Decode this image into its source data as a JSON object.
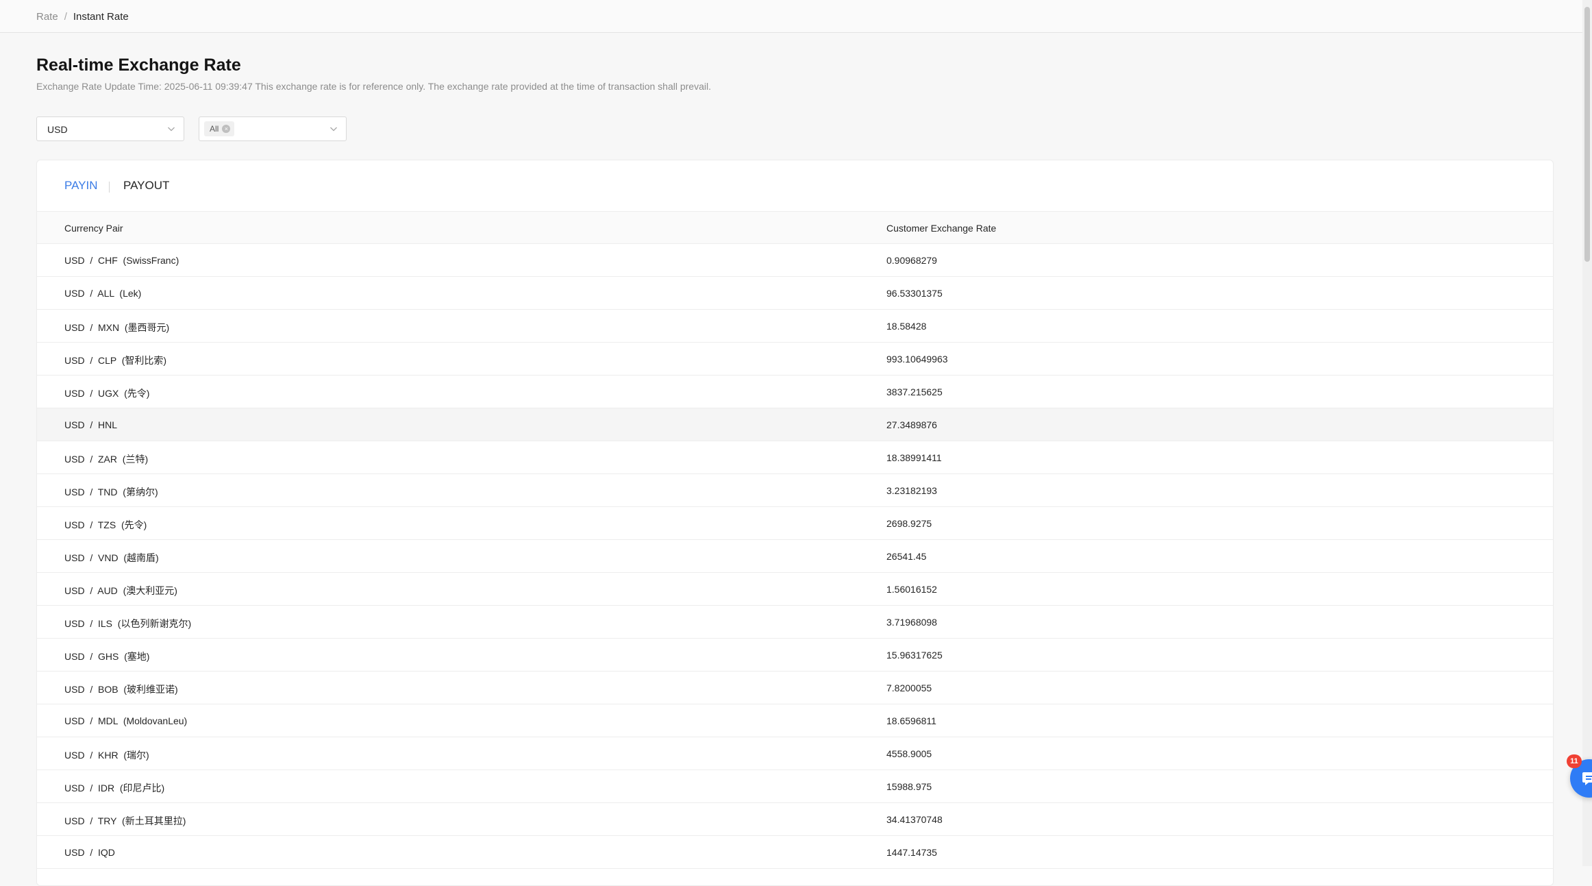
{
  "breadcrumb": {
    "parent": "Rate",
    "separator": "/",
    "current": "Instant Rate"
  },
  "page": {
    "title": "Real-time Exchange Rate",
    "update_text": "Exchange Rate Update Time: 2025-06-11 09:39:47 This exchange rate is for reference only. The exchange rate provided at the time of transaction shall prevail."
  },
  "filters": {
    "currency_value": "USD",
    "region_tag": "All",
    "region_tag_clear": "×"
  },
  "tabs": {
    "payin": "PAYIN",
    "payout": "PAYOUT",
    "active": "PAYIN"
  },
  "table": {
    "headers": [
      "Currency Pair",
      "Customer Exchange Rate"
    ],
    "rows": [
      {
        "pair": "USD  /  CHF  (SwissFranc)",
        "rate": "0.90968279"
      },
      {
        "pair": "USD  /  ALL  (Lek)",
        "rate": "96.53301375"
      },
      {
        "pair": "USD  /  MXN  (墨西哥元)",
        "rate": "18.58428"
      },
      {
        "pair": "USD  /  CLP  (智利比索)",
        "rate": "993.10649963"
      },
      {
        "pair": "USD  /  UGX  (先令)",
        "rate": "3837.215625"
      },
      {
        "pair": "USD  /  HNL",
        "rate": "27.3489876"
      },
      {
        "pair": "USD  /  ZAR  (兰特)",
        "rate": "18.38991411"
      },
      {
        "pair": "USD  /  TND  (第纳尔)",
        "rate": "3.23182193"
      },
      {
        "pair": "USD  /  TZS  (先令)",
        "rate": "2698.9275"
      },
      {
        "pair": "USD  /  VND  (越南盾)",
        "rate": "26541.45"
      },
      {
        "pair": "USD  /  AUD  (澳大利亚元)",
        "rate": "1.56016152"
      },
      {
        "pair": "USD  /  ILS  (以色列新谢克尔)",
        "rate": "3.71968098"
      },
      {
        "pair": "USD  /  GHS  (塞地)",
        "rate": "15.96317625"
      },
      {
        "pair": "USD  /  BOB  (玻利维亚诺)",
        "rate": "7.8200055"
      },
      {
        "pair": "USD  /  MDL  (MoldovanLeu)",
        "rate": "18.6596811"
      },
      {
        "pair": "USD  /  KHR  (瑞尔)",
        "rate": "4558.9005"
      },
      {
        "pair": "USD  /  IDR  (印尼卢比)",
        "rate": "15988.975"
      },
      {
        "pair": "USD  /  TRY  (新土耳其里拉)",
        "rate": "34.41370748"
      },
      {
        "pair": "USD  /  IQD",
        "rate": "1447.14735"
      }
    ]
  },
  "chat": {
    "badge_count": "11",
    "icon": "chat-icon"
  },
  "colors": {
    "accent": "#3b7ce6",
    "badge": "#f04134",
    "fab": "#2f7cf6"
  }
}
